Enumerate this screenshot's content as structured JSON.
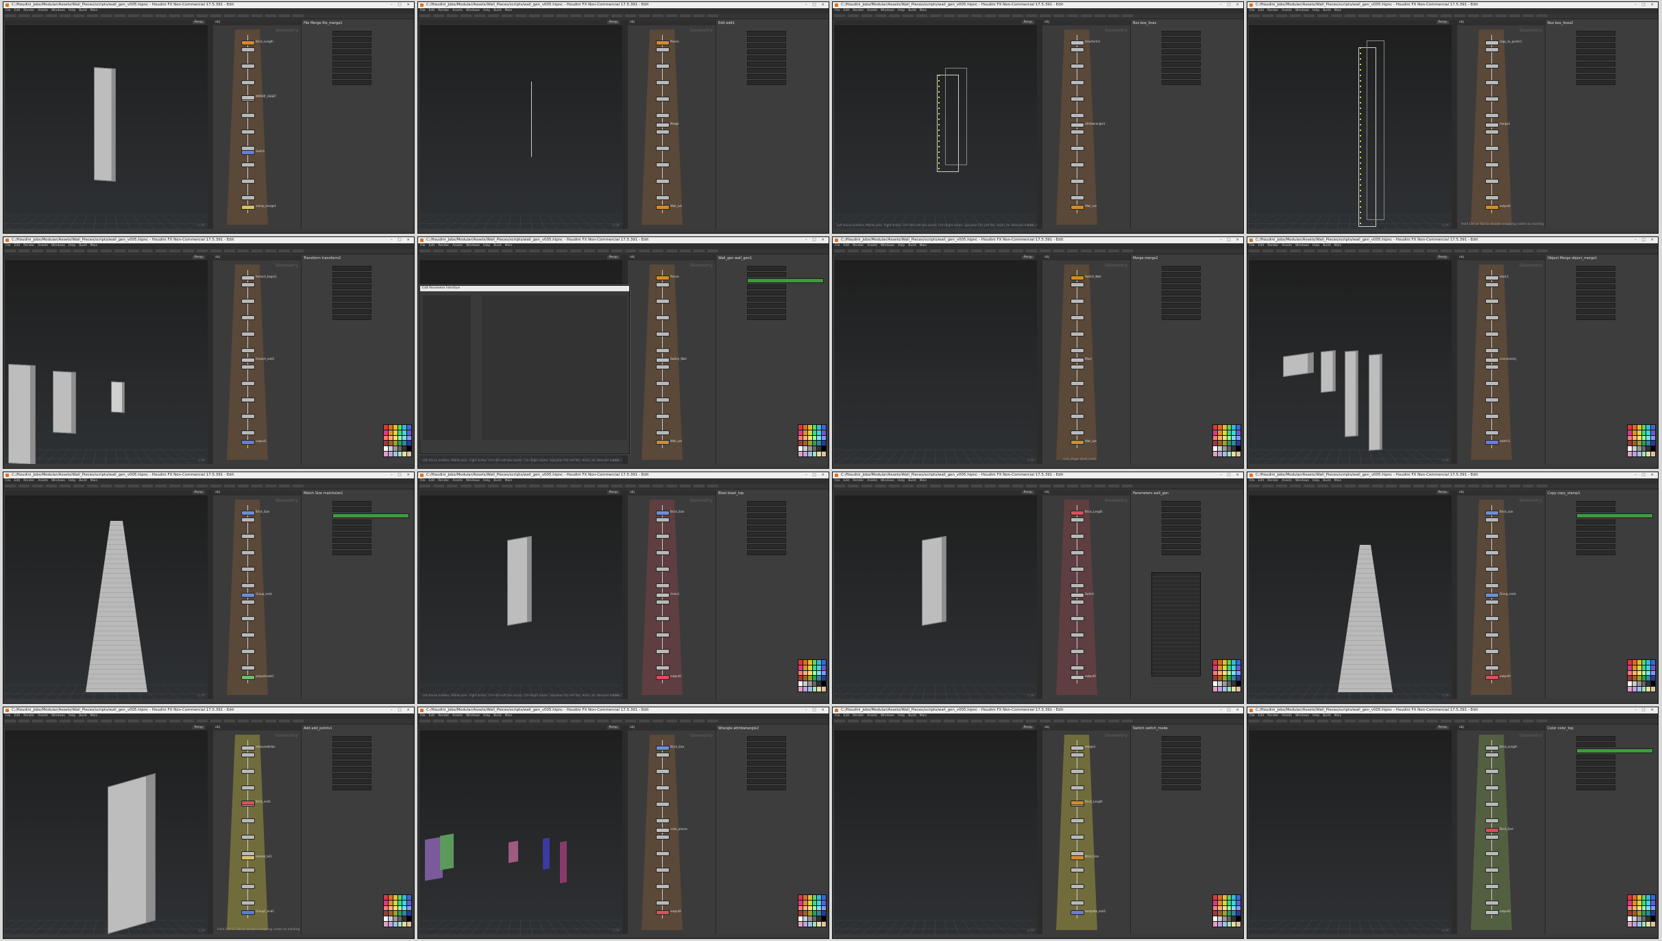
{
  "window": {
    "title": "C:/Houdini_Jobs/Modular/Assets/Wall_Pieces/scripts/wall_gen_v005.hipnc - Houdini FX Non-Commercial 17.5.391 - Edit",
    "buttons": "– □ ×"
  },
  "menus": [
    "File",
    "Edit",
    "Render",
    "Assets",
    "Windows",
    "Help",
    "Build",
    "Main"
  ],
  "viewport": {
    "persp_label": "Persp",
    "status_text": "Left mouse tumbles. Middle pans. Right dollies. Ctrl+Alt+Left box-zooms. Ctrl+Right zooms. Spacebar-Ctrl-Left tilts. Hold L for alternate tumble, dolly, and zoom.",
    "corner_text": "1    1%"
  },
  "network": {
    "context": "obj",
    "watermark": "Geometry"
  },
  "hint_texts": {
    "ctrl_tab": "Hold Ctrl or Tab to disable snapping nodes to existing wires",
    "exit_stage": "exit_stage ($sel_mat)"
  },
  "thumbnails": [
    {
      "parm_title": "File Merge  file_merge1",
      "nodes": [
        {
          "label": "Brick_Length",
          "color": "#d48a2a"
        },
        {
          "label": "IMPORT_ASSET",
          "color": "#bdbdbd"
        },
        {
          "label": "Switch",
          "color": "#6a7bd8"
        },
        {
          "label": "stamp_merge1",
          "color": "#d8c06a"
        }
      ],
      "scene": "single-wall"
    },
    {
      "parm_title": "Edit  edit1",
      "nodes": [
        {
          "label": "Pieces",
          "color": "#d48a2a"
        },
        {
          "label": "Merge",
          "color": "#bdbdbd"
        },
        {
          "label": "Wall_out",
          "color": "#d48a2a"
        }
      ],
      "scene": "line"
    },
    {
      "parm_title": "Box  box_lines",
      "nodes": [
        {
          "label": "transform1",
          "color": "#bdbdbd"
        },
        {
          "label": "attribwrangle1",
          "color": "#bdbdbd"
        },
        {
          "label": "Wall_out",
          "color": "#d48a2a"
        }
      ],
      "scene": "wire-box"
    },
    {
      "parm_title": "Box  box_lines2",
      "nodes": [
        {
          "label": "copy_to_points1",
          "color": "#bdbdbd"
        },
        {
          "label": "merge1",
          "color": "#bdbdbd"
        },
        {
          "label": "output0",
          "color": "#d48a2a"
        }
      ],
      "scene": "tall-wire-box"
    },
    {
      "parm_title": "Transform  transform2",
      "nodes": [
        {
          "label": "foreach_begin1",
          "color": "#bdbdbd"
        },
        {
          "label": "foreach_end1",
          "color": "#bdbdbd"
        },
        {
          "label": "output1",
          "color": "#6a7bd8"
        }
      ],
      "scene": "multi-walls"
    },
    {
      "parm_title": "Wall_gen  wall_gen1",
      "dialog_title": "Edit Parameter Interface",
      "nodes": [
        {
          "label": "Pieces",
          "color": "#d48a2a"
        },
        {
          "label": "Switch_Wall",
          "color": "#bdbdbd"
        },
        {
          "label": "Wall_out",
          "color": "#d48a2a"
        }
      ],
      "scene": "dialog"
    },
    {
      "parm_title": "Merge  merge2",
      "nodes": [
        {
          "label": "Switch_Wall",
          "color": "#d48a2a"
        },
        {
          "label": "Blast",
          "color": "#bdbdbd"
        },
        {
          "label": "Wall_out",
          "color": "#d48a2a"
        }
      ],
      "scene": "empty-grid"
    },
    {
      "parm_title": "Object Merge  object_merge1",
      "nodes": [
        {
          "label": "stack1",
          "color": "#bdbdbd"
        },
        {
          "label": "connectivity",
          "color": "#bdbdbd"
        },
        {
          "label": "switch1",
          "color": "#6a7bd8"
        }
      ],
      "scene": "tilted-walls"
    },
    {
      "parm_title": "Match Size  matchsize1",
      "nodes": [
        {
          "label": "Brick_Size",
          "color": "#6a8fd8"
        },
        {
          "label": "Group_ends",
          "color": "#6a8fd8"
        },
        {
          "label": "polyextrude1",
          "color": "#6ac06a"
        }
      ],
      "scene": "tall-tapered"
    },
    {
      "parm_title": "Blast  blast_top",
      "nodes": [
        {
          "label": "Brick_Size",
          "color": "#6a8fd8"
        },
        {
          "label": "clean1",
          "color": "#bdbdbd"
        },
        {
          "label": "output0",
          "color": "#d8505a"
        }
      ],
      "scene": "small-wall"
    },
    {
      "parm_title": "Parameters  wall_gen",
      "nodes": [
        {
          "label": "Brick_Length",
          "color": "#d8505a"
        },
        {
          "label": "Switch",
          "color": "#bdbdbd"
        },
        {
          "label": "output0",
          "color": "#bdbdbd"
        }
      ],
      "scene": "small-wall-menu"
    },
    {
      "parm_title": "Copy  copy_stamp1",
      "nodes": [
        {
          "label": "Brick_size",
          "color": "#6a8fd8"
        },
        {
          "label": "Group_ends",
          "color": "#6a8fd8"
        },
        {
          "label": "output0",
          "color": "#d8505a"
        }
      ],
      "scene": "tall-tapered-2"
    },
    {
      "parm_title": "Add  add_points1",
      "nodes": [
        {
          "label": "removeattribs",
          "color": "#bdbdbd"
        },
        {
          "label": "Brick_end1",
          "color": "#d8505a"
        },
        {
          "label": "normal_tol1",
          "color": "#d8c06a"
        },
        {
          "label": "Group1_end1",
          "color": "#5a7bd8"
        }
      ],
      "scene": "big-wall"
    },
    {
      "parm_title": "Wrangle  attribwrangle2",
      "nodes": [
        {
          "label": "Brick_Size",
          "color": "#6a8fd8"
        },
        {
          "label": "color_pieces",
          "color": "#bdbdbd"
        },
        {
          "label": "output0",
          "color": "#d8505a"
        }
      ],
      "scene": "colored-bricks"
    },
    {
      "parm_title": "Switch  switch_mode",
      "nodes": [
        {
          "label": "merge1",
          "color": "#bdbdbd"
        },
        {
          "label": "Brick_Length",
          "color": "#d48a2a"
        },
        {
          "label": "Brick_Size",
          "color": "#d48a2a"
        },
        {
          "label": "template_end1",
          "color": "#6a7bd8"
        }
      ],
      "scene": "empty-grid-yellow"
    },
    {
      "parm_title": "Color  color_top",
      "nodes": [
        {
          "label": "Brick_Length",
          "color": "#bdbdbd"
        },
        {
          "label": "Brick_End",
          "color": "#d8505a"
        },
        {
          "label": "output0",
          "color": "#bdbdbd"
        }
      ],
      "scene": "empty-grid-green"
    }
  ],
  "palette_colors": [
    "#d83a3a",
    "#e06a2a",
    "#e0c02a",
    "#5ad85a",
    "#3ab8d8",
    "#3a6ad8",
    "#d83a8a",
    "#e0902a",
    "#d8d83a",
    "#3ad88a",
    "#3ad8d8",
    "#6a5ad8",
    "#ff7a7a",
    "#ffb07a",
    "#ffe07a",
    "#9aff9a",
    "#7ae0ff",
    "#7a9aff",
    "#a03a3a",
    "#a0602a",
    "#a0a02a",
    "#2aa05a",
    "#2a8aa0",
    "#2a3aa0",
    "#ffffff",
    "#cccccc",
    "#999999",
    "#666666",
    "#333333",
    "#000000",
    "#e0a0c0",
    "#c0a0e0",
    "#a0c0e0",
    "#a0e0c0",
    "#e0e0a0",
    "#e0c0a0"
  ]
}
